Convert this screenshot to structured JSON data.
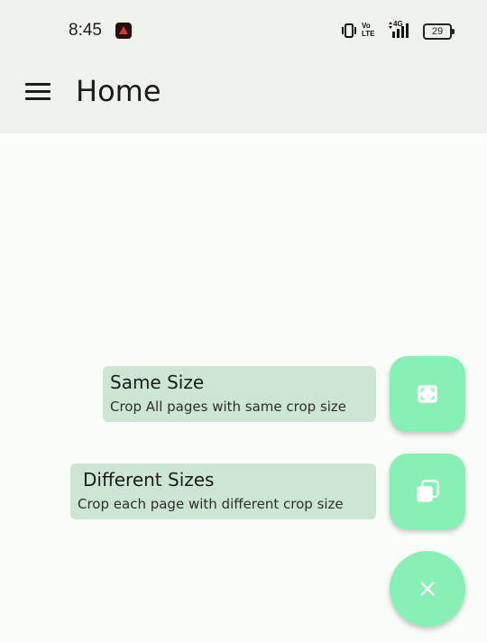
{
  "status_bar": {
    "time": "8:45",
    "battery": "29",
    "volte_top": "Vo",
    "volte_bottom": "LTE",
    "network": "4G"
  },
  "app_bar": {
    "title": "Home",
    "menu_icon": "menu-icon"
  },
  "crop_options": [
    {
      "title": "Same Size",
      "subtitle": "Crop All pages with same crop size",
      "icon": "fullscreen-crop-icon"
    },
    {
      "title": "Different Sizes",
      "subtitle": "Crop each page with different crop size",
      "icon": "stacked-pages-icon"
    }
  ],
  "fab_main": {
    "icon": "close-icon"
  },
  "colors": {
    "fab": "#86f0b5",
    "option_label_bg": "#cde6d4",
    "app_bar_bg": "#eff1ed",
    "background": "#fafcf9"
  }
}
